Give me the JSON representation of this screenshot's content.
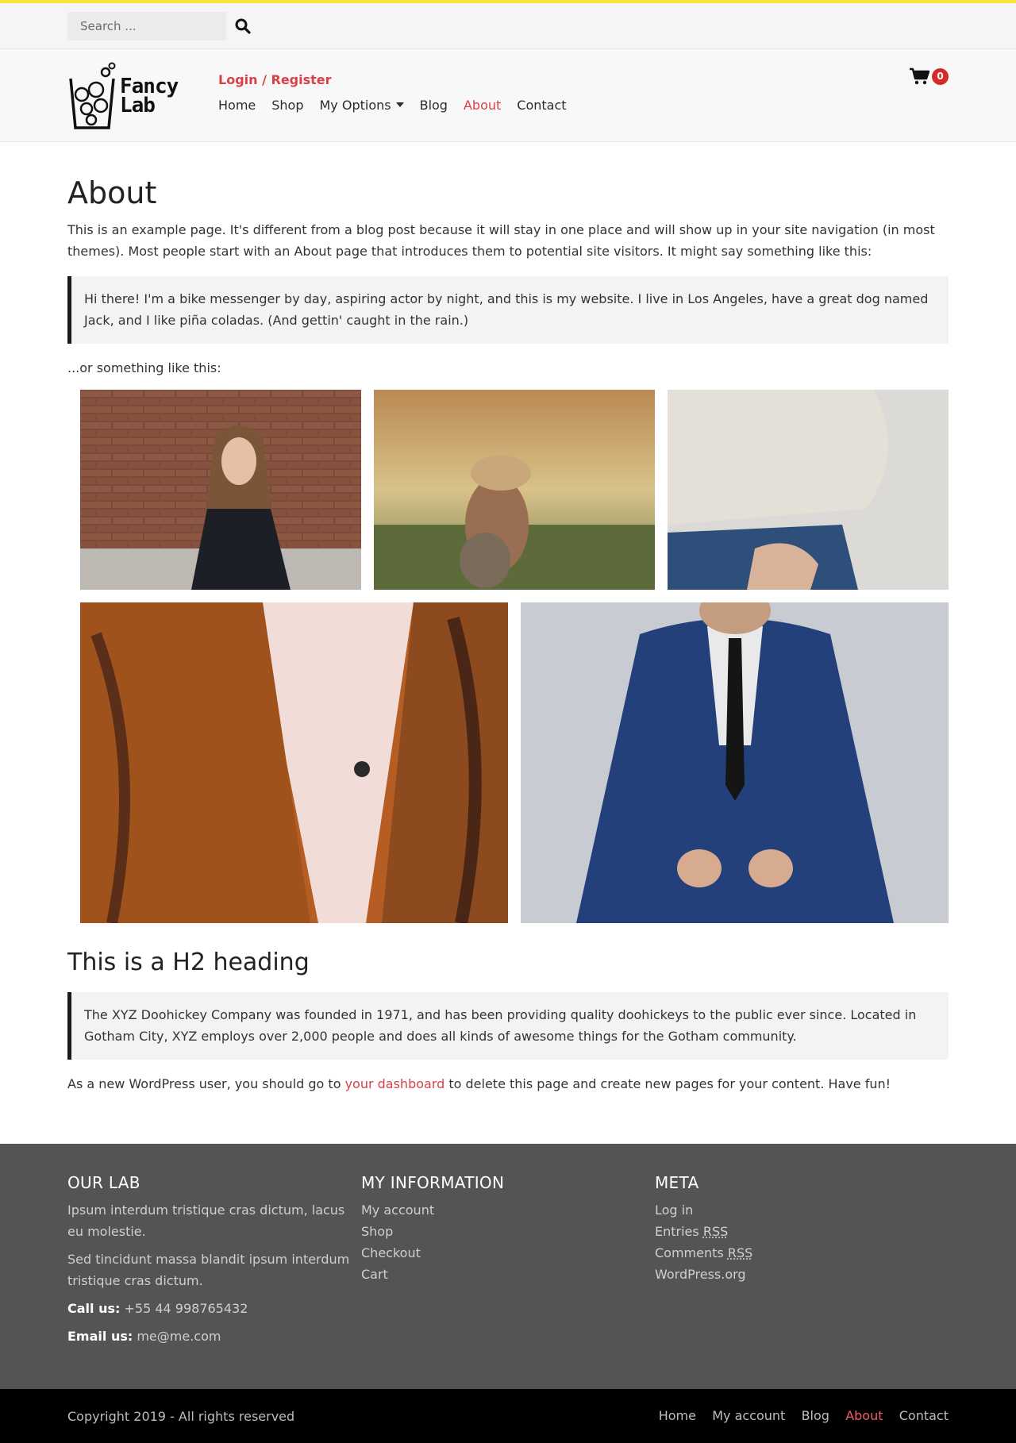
{
  "search": {
    "placeholder": "Search ..."
  },
  "header": {
    "logo_line1": "Fancy",
    "logo_line2": "Lab",
    "login_label": "Login / Register",
    "nav": [
      "Home",
      "Shop",
      "My Options",
      "Blog",
      "About",
      "Contact"
    ],
    "active_nav": "About",
    "cart_count": "0"
  },
  "page": {
    "title": "About",
    "intro": "This is an example page. It's different from a blog post because it will stay in one place and will show up in your site navigation (in most themes). Most people start with an About page that introduces them to potential site visitors. It might say something like this:",
    "quote1": "Hi there! I'm a bike messenger by day, aspiring actor by night, and this is my website. I live in Los Angeles, have a great dog named Jack, and I like piña coladas. (And gettin' caught in the rain.)",
    "or_text": "...or something like this:",
    "h2": "This is a H2 heading",
    "quote2": "The XYZ Doohickey Company was founded in 1971, and has been providing quality doohickeys to the public ever since. Located in Gotham City, XYZ employs over 2,000 people and does all kinds of awesome things for the Gotham community.",
    "final_before": "As a new WordPress user, you should go to ",
    "final_link": "your dashboard",
    "final_after": " to delete this page and create new pages for your content. Have fun!"
  },
  "footer": {
    "col1": {
      "title": "OUR LAB",
      "p1": "Ipsum interdum tristique cras dictum, lacus eu molestie.",
      "p2": "Sed tincidunt massa blandit ipsum interdum tristique cras dictum.",
      "call_label": "Call us:",
      "call_value": "+55 44 998765432",
      "email_label": "Email us:",
      "email_value": "me@me.com"
    },
    "col2": {
      "title": "MY INFORMATION",
      "links": [
        "My account",
        "Shop",
        "Checkout",
        "Cart"
      ]
    },
    "col3": {
      "title": "META",
      "links": [
        "Log in",
        "Entries",
        "Comments",
        "WordPress.org"
      ],
      "rss": "RSS"
    }
  },
  "bottom": {
    "copyright": "Copyright 2019 - All rights reserved",
    "nav": [
      "Home",
      "My account",
      "Blog",
      "About",
      "Contact"
    ]
  },
  "colors": {
    "accent": "#d9404a",
    "topbar_stripe": "#f7e73b",
    "footer_bg": "#545454",
    "bottom_bg": "#000000"
  }
}
